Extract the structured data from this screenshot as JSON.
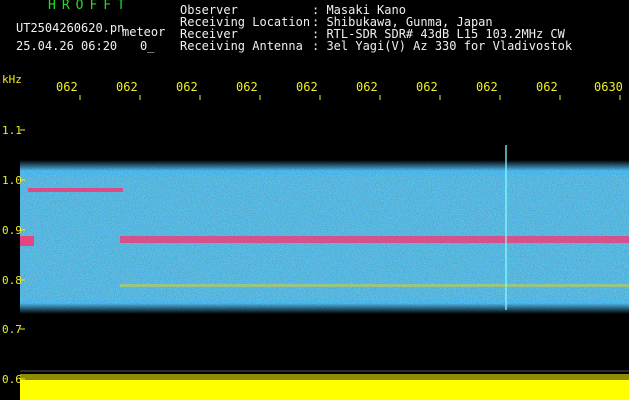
{
  "header": {
    "logo": "HROFFT",
    "filename": "UT2504260620.pn",
    "filename_suffix": "meteor",
    "datetime": "25.04.26 06:20",
    "datetime_extra": "0_",
    "info": [
      {
        "label": "Observer",
        "value": ": Masaki Kano"
      },
      {
        "label": "Receiving Location",
        "value": ": Shibukawa, Gunma, Japan"
      },
      {
        "label": "Receiver",
        "value": ": RTL-SDR SDR# 43dB L15 103.2MHz CW"
      },
      {
        "label": "Receiving Antenna",
        "value": ": 3el Yagi(V) Az 330 for Vladivostok"
      }
    ]
  },
  "axis": {
    "unit": "kHz",
    "y_ticks": [
      "1.1",
      "1.0",
      "0.9",
      "0.8",
      "0.7",
      "0.6"
    ],
    "x_ticks": [
      "062",
      "062",
      "062",
      "062",
      "062",
      "062",
      "062",
      "062",
      "062",
      "0630"
    ]
  },
  "colors": {
    "background": "#000000",
    "axis_text": "#f0f020",
    "logo": "#22dd22",
    "signal": "#ff3070",
    "noise_low": "#0a1a8a",
    "noise_high": "#20d0d0",
    "power_bar": "#ffff00"
  },
  "display": {
    "type": "spectrogram",
    "y_range_khz": [
      0.6,
      1.15
    ],
    "signal_trace_khz": 0.89,
    "meteor_echo_position": "near 06:29"
  }
}
